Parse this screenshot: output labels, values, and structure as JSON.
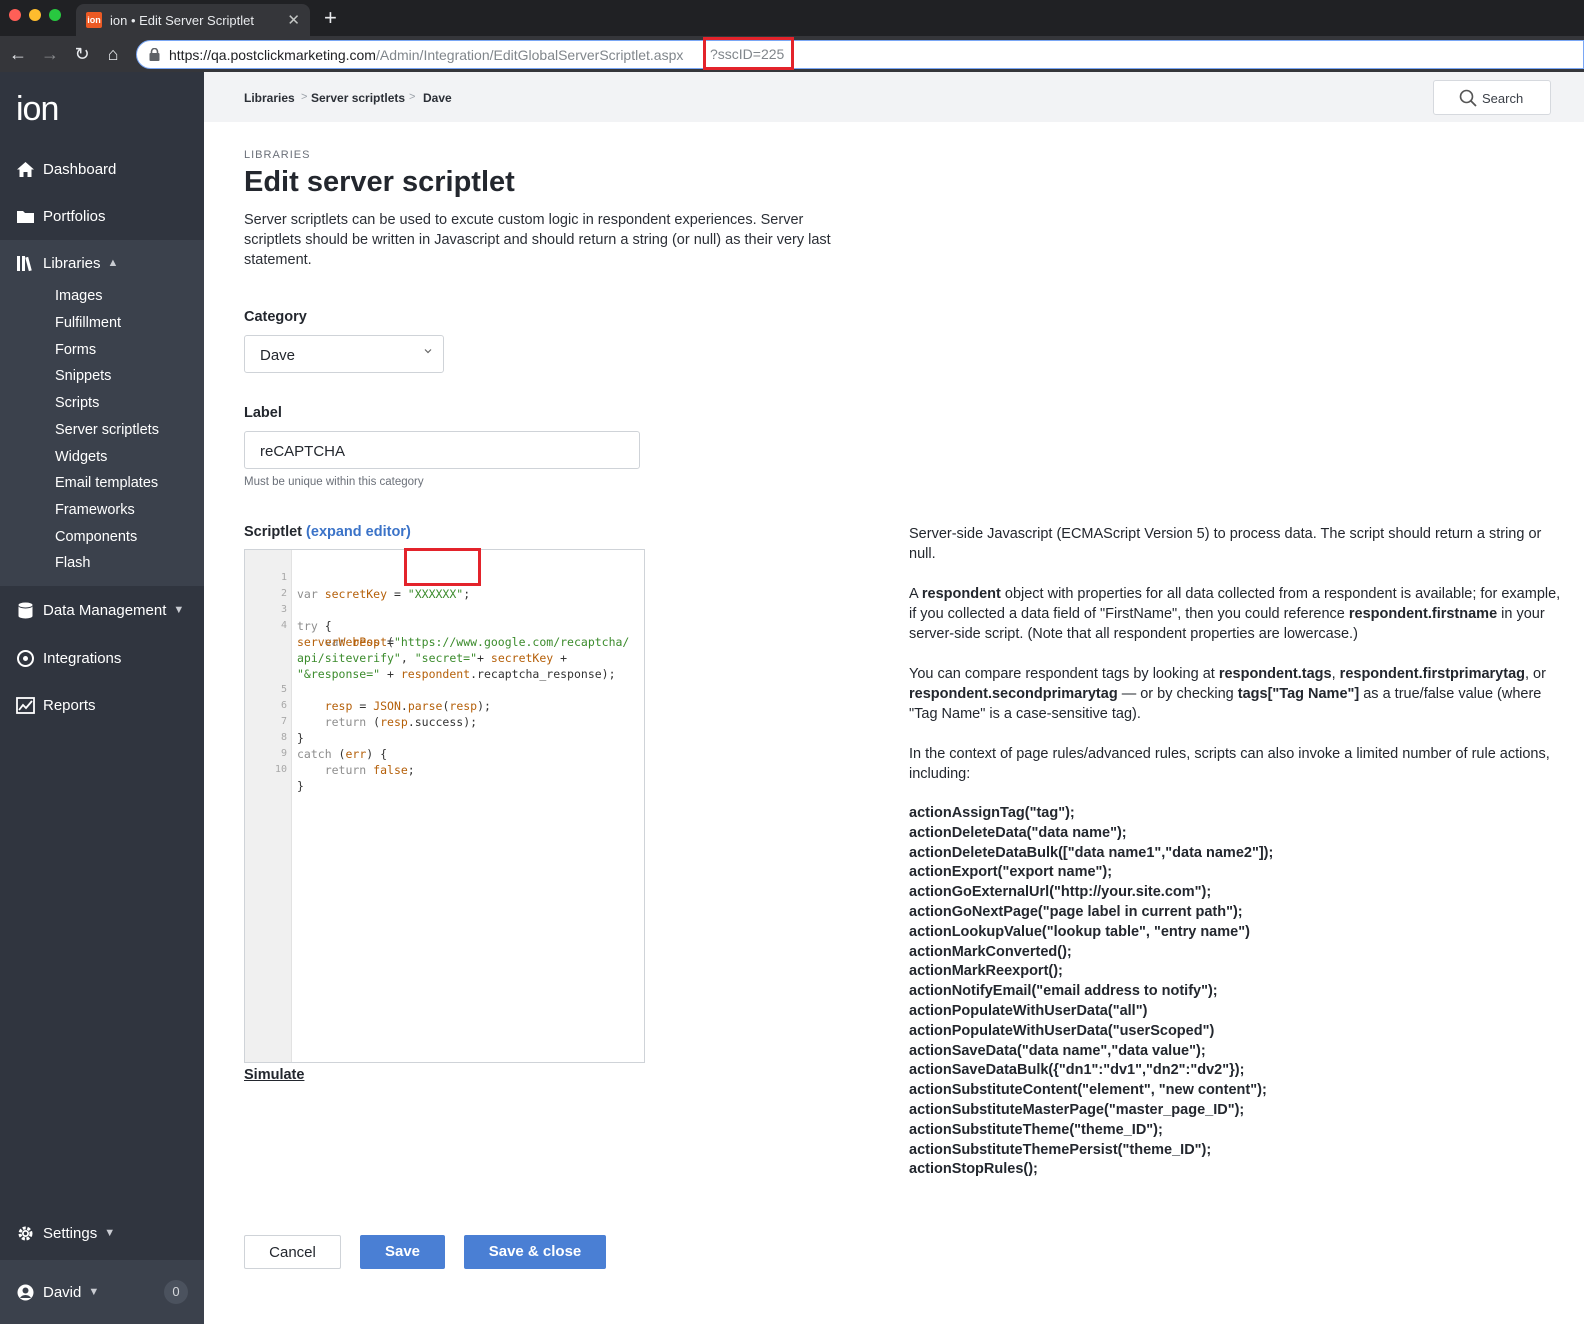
{
  "browser": {
    "tab_title": "ion • Edit Server Scriptlet",
    "tab_favicon": "ion",
    "url_host": "https://qa.postclickmarketing.com",
    "url_path": "/Admin/Integration/EditGlobalServerScriptlet.aspx",
    "url_query": "?sscID=225"
  },
  "sidebar": {
    "logo": "ion",
    "items": {
      "dashboard": "Dashboard",
      "portfolios": "Portfolios",
      "libraries": "Libraries",
      "data_management": "Data Management",
      "integrations": "Integrations",
      "reports": "Reports",
      "settings": "Settings"
    },
    "library_items": [
      "Images",
      "Fulfillment",
      "Forms",
      "Snippets",
      "Scripts",
      "Server scriptlets",
      "Widgets",
      "Email templates",
      "Frameworks",
      "Components",
      "Flash"
    ],
    "user": {
      "name": "David",
      "count": "0"
    }
  },
  "breadcrumb": [
    "Libraries",
    "Server scriptlets",
    "Dave"
  ],
  "search": {
    "label": "Search"
  },
  "page": {
    "eyebrow": "LIBRARIES",
    "title": "Edit server scriptlet",
    "description": "Server scriptlets can be used to excute custom logic in respondent experiences. Server scriptlets should be written in Javascript and should return a string (or null) as their very last statement."
  },
  "form": {
    "category_label": "Category",
    "category_value": "Dave",
    "label_label": "Label",
    "label_value": "reCAPTCHA",
    "label_help": "Must be unique within this category",
    "scriptlet_label": "Scriptlet",
    "expand_editor": "(expand editor)",
    "simulate": "Simulate"
  },
  "code_lines": {
    "l1": {
      "num": "1",
      "a": "var ",
      "b": "secretKey",
      "c": " = ",
      "d": "\"XXXXXX\"",
      "e": ";"
    },
    "l2": {
      "num": "2"
    },
    "l3": {
      "num": "3",
      "a": "try",
      "b": " {"
    },
    "l4": {
      "num": "4",
      "a": "    var ",
      "b": "resp",
      "c": " ="
    },
    "l4b": {
      "a": "serverWebPost",
      "b": "(",
      "c": "\"https://www.google.com/recaptcha/"
    },
    "l4c": {
      "a": "api/siteverify\"",
      "b": ", ",
      "c": "\"secret=\"",
      "d": "+ ",
      "e": "secretKey",
      "f": " +"
    },
    "l4d": {
      "a": "\"&response=\"",
      "b": " + ",
      "c": "respondent",
      "d": ".recaptcha_response);"
    },
    "l5": {
      "num": "5",
      "a": "    ",
      "b": "resp",
      "c": " = ",
      "d": "JSON",
      "e": ".",
      "f": "parse",
      "g": "(",
      "h": "resp",
      "i": ");"
    },
    "l6": {
      "num": "6",
      "a": "    return ",
      "b": "(",
      "c": "resp",
      "d": ".success);"
    },
    "l7": {
      "num": "7",
      "a": "}"
    },
    "l8": {
      "num": "8",
      "a": "catch",
      "b": " (",
      "c": "err",
      "d": ") {"
    },
    "l9": {
      "num": "9",
      "a": "    return ",
      "b": "false",
      "c": ";"
    },
    "l10": {
      "num": "10",
      "a": "}"
    }
  },
  "docs": {
    "p1": "Server-side Javascript (ECMAScript Version 5) to process data. The script should return a string or null.",
    "p2_a": "A ",
    "p2_b": "respondent",
    "p2_c": " object with properties for all data collected from a respondent is available; for example, if you collected a data field of \"FirstName\", then you could reference ",
    "p2_d": "respondent.firstname",
    "p2_e": " in your server-side script. (Note that all respondent properties are lowercase.)",
    "p3_a": "You can compare respondent tags by looking at ",
    "p3_b": "respondent.tags",
    "p3_c": ", ",
    "p3_d": "respondent.firstprimarytag",
    "p3_e": ", or ",
    "p3_f": "respondent.secondprimarytag",
    "p3_g": " — or by checking ",
    "p3_h": "tags[\"Tag Name\"]",
    "p3_i": " as a true/false value (where \"Tag Name\" is a case-sensitive tag).",
    "p4": "In the context of page rules/advanced rules, scripts can also invoke a limited number of rule actions, including:",
    "actions": [
      "actionAssignTag(\"tag\");",
      "actionDeleteData(\"data name\");",
      "actionDeleteDataBulk([\"data name1\",\"data name2\"]);",
      "actionExport(\"export name\");",
      "actionGoExternalUrl(\"http://your.site.com\");",
      "actionGoNextPage(\"page label in current path\");",
      "actionLookupValue(\"lookup table\", \"entry name\")",
      "actionMarkConverted();",
      "actionMarkReexport();",
      "actionNotifyEmail(\"email address to notify\");",
      "actionPopulateWithUserData(\"all\")",
      "actionPopulateWithUserData(\"userScoped\")",
      "actionSaveData(\"data name\",\"data value\");",
      "actionSaveDataBulk({\"dn1\":\"dv1\",\"dn2\":\"dv2\"});",
      "actionSubstituteContent(\"element\", \"new content\");",
      "actionSubstituteMasterPage(\"master_page_ID\");",
      "actionSubstituteTheme(\"theme_ID\");",
      "actionSubstituteThemePersist(\"theme_ID\");",
      "actionStopRules();"
    ]
  },
  "buttons": {
    "cancel": "Cancel",
    "save": "Save",
    "save_close": "Save & close"
  },
  "colors": {
    "accent": "#4a7fd4",
    "sidebar": "#30353f",
    "annotation": "#e3232b"
  }
}
